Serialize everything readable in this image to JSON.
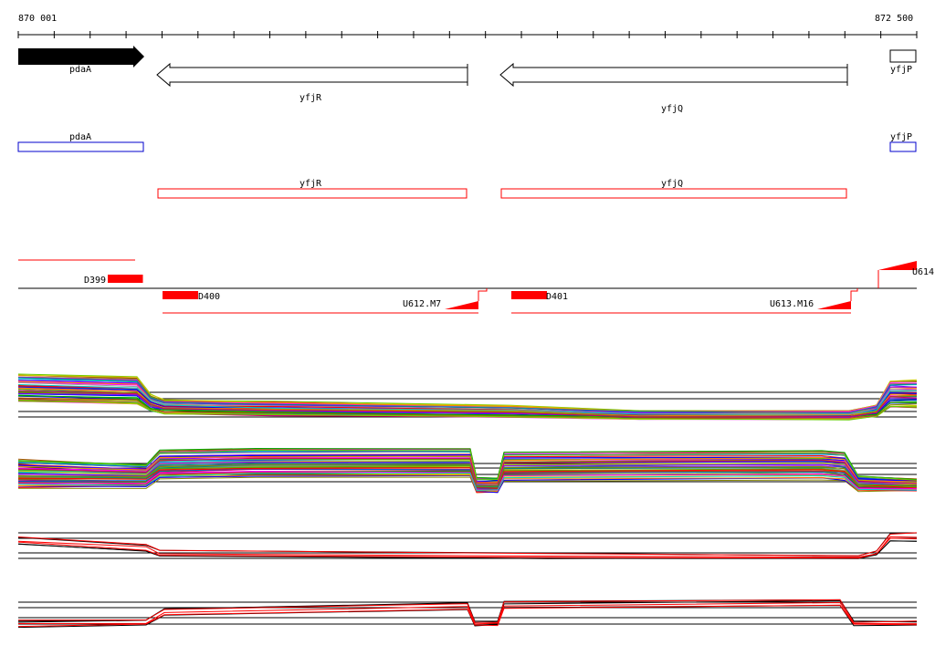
{
  "ruler": {
    "start_label": "870 001",
    "end_label": "872 500"
  },
  "genes": {
    "pdaA": "pdaA",
    "yfjR": "yfjR",
    "yfjQ": "yfjQ",
    "yfjP": "yfjP"
  },
  "segments": {
    "d399": "D399",
    "d400": "D400",
    "d401": "D401",
    "u612": "U612.M7",
    "u613": "U613.M16",
    "u614": "U614"
  },
  "colors": {
    "forward_gene_fill": "#000000",
    "reverse_gene_outline": "#000000",
    "blue_feature": "#0000cc",
    "red_feature": "#ff0000",
    "axis": "#000000"
  }
}
